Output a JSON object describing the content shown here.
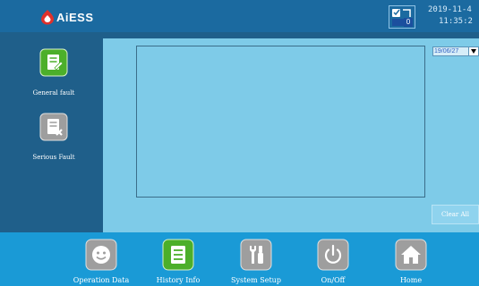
{
  "header": {
    "brand": "AiESS",
    "message_count": "0",
    "datetime_line1": "2019-11-4",
    "datetime_line2": "11:35:2"
  },
  "sidebar": {
    "items": [
      {
        "label": "General fault",
        "icon": "note-edit-icon",
        "color": "#4caf2a"
      },
      {
        "label": "Serious Fault",
        "icon": "note-delete-icon",
        "color": "#9e9e9e"
      }
    ]
  },
  "main": {
    "date_select_value": "19/06/27",
    "clear_all_label": "Clear All"
  },
  "bottom_nav": {
    "items": [
      {
        "label": "Operation Data",
        "icon": "smiley-icon"
      },
      {
        "label": "History Info",
        "icon": "list-icon",
        "active": true
      },
      {
        "label": "System Setup",
        "icon": "tools-icon"
      },
      {
        "label": "On/Off",
        "icon": "power-icon"
      },
      {
        "label": "Home",
        "icon": "home-icon"
      }
    ]
  },
  "colors": {
    "topbar": "#1b6aa0",
    "sidebar": "#1f5f8a",
    "content": "#7ecbe8",
    "bottombar": "#1a9ad6",
    "active_icon": "#4caf2a",
    "inactive_icon": "#9e9e9e"
  }
}
